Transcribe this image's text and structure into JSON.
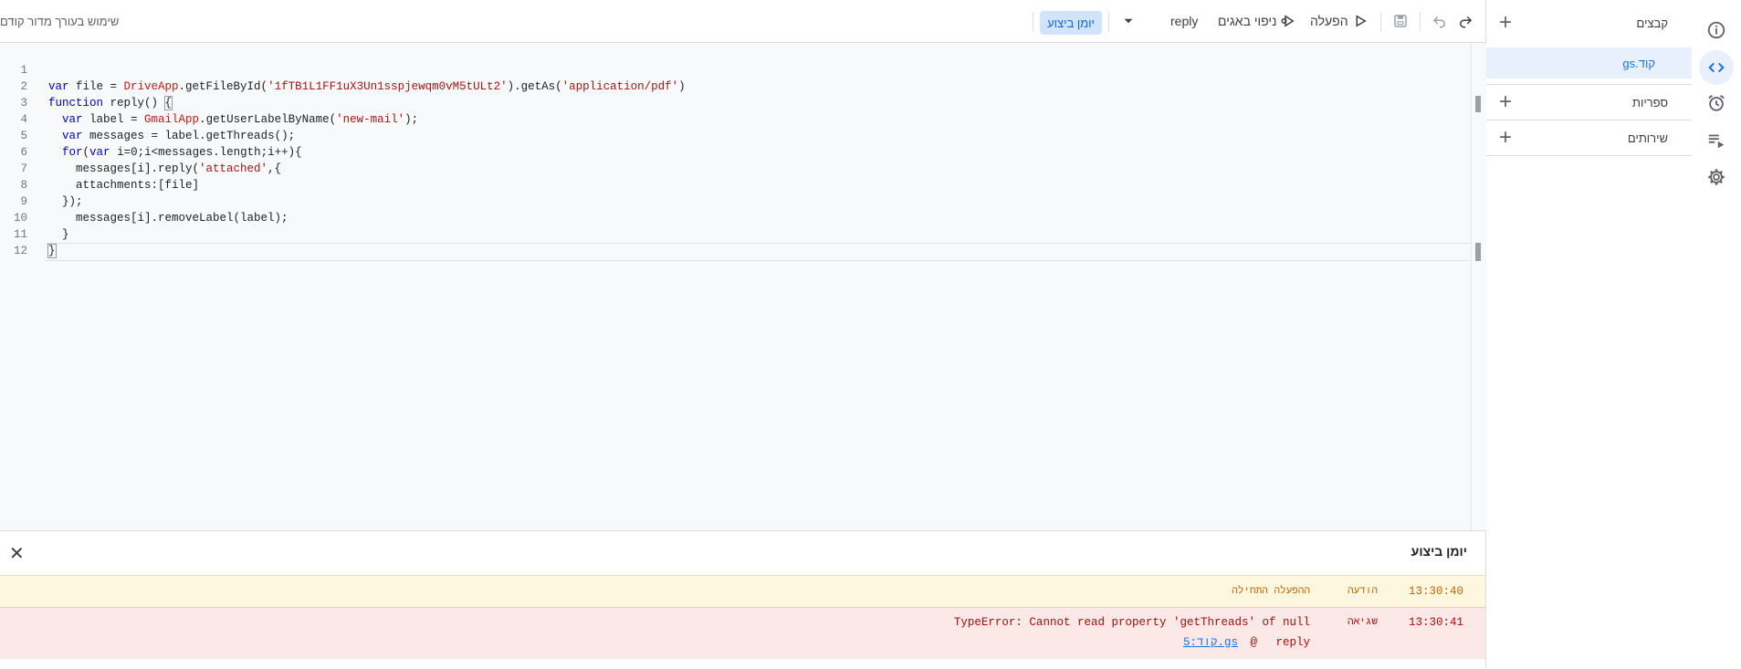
{
  "toolbar": {
    "run_label": "הפעלה",
    "debug_label": "ניפוי באגים",
    "function_name": "reply",
    "execution_log_label": "יומן ביצוע",
    "legacy_editor_label": "שימוש בעורך מדור קודם"
  },
  "files_panel": {
    "files_label": "קבצים",
    "libraries_label": "ספריות",
    "services_label": "שירותים",
    "active_file": "קוד.gs"
  },
  "editor": {
    "line_numbers": [
      "1",
      "2",
      "3",
      "4",
      "5",
      "6",
      "7",
      "8",
      "9",
      "10",
      "11",
      "12"
    ]
  },
  "log": {
    "title": "יומן ביצוע",
    "rows": [
      {
        "time": "13:30:40",
        "level": "הודעה",
        "message": "ההפעלה התחילה"
      },
      {
        "time": "13:30:41",
        "level": "שגיאה",
        "message": "TypeError: Cannot read property 'getThreads' of null",
        "trace_func": "reply",
        "trace_at": "@",
        "trace_link": "קוד:5.gs"
      }
    ]
  },
  "colors": {
    "accent": "#1a73e8",
    "info_bg": "#fef7e0",
    "error_bg": "#fce8e6"
  },
  "icons": [
    "info-icon",
    "code-icon",
    "alarm-clock-icon",
    "playlist-play-icon",
    "gear-icon",
    "plus-icon",
    "redo-icon",
    "undo-icon",
    "save-icon",
    "run-icon",
    "debug-icon",
    "dropdown-icon",
    "close-icon"
  ]
}
